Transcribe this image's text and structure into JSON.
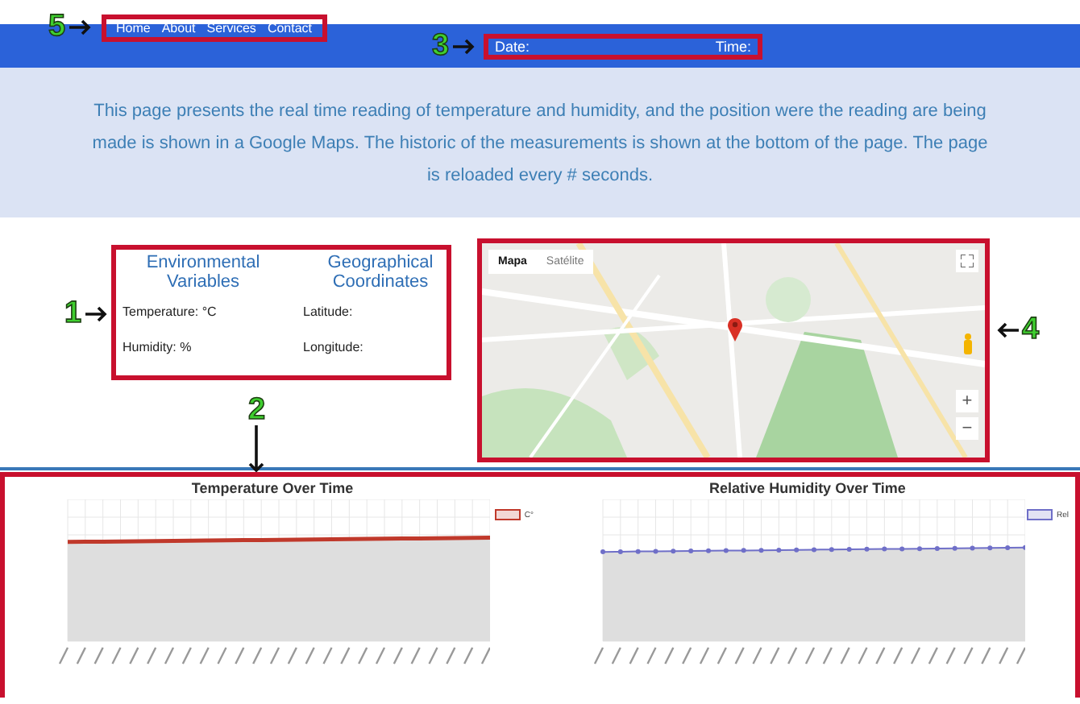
{
  "nav": {
    "marker": "5",
    "links": [
      "Home",
      "About",
      "Services",
      "Contact"
    ]
  },
  "datetime": {
    "marker": "3",
    "date_label": "Date:",
    "time_label": "Time:"
  },
  "intro": "This page presents the real time reading of temperature and humidity, and the position were the reading are being made is shown in a Google Maps. The historic of the measurements is shown at the bottom of the page. The page is reloaded every # seconds.",
  "readings": {
    "marker": "1",
    "columns": [
      {
        "heading": "Environmental Variables",
        "rows": [
          "Temperature: °C",
          "Humidity: %"
        ]
      },
      {
        "heading": "Geographical Coordinates",
        "rows": [
          "Latitude:",
          "Longitude:"
        ]
      }
    ]
  },
  "map": {
    "marker": "4",
    "map_types": [
      {
        "label": "Mapa",
        "selected": true
      },
      {
        "label": "Satélite",
        "selected": false
      }
    ],
    "zoom_in": "+",
    "zoom_out": "−"
  },
  "history": {
    "marker": "2",
    "charts": [
      {
        "title": "Temperature Over Time",
        "legend": "C°",
        "color": "#c0392b"
      },
      {
        "title": "Relative Humidity Over Time",
        "legend": "Rel",
        "color": "#6f6fc8"
      }
    ]
  }
}
